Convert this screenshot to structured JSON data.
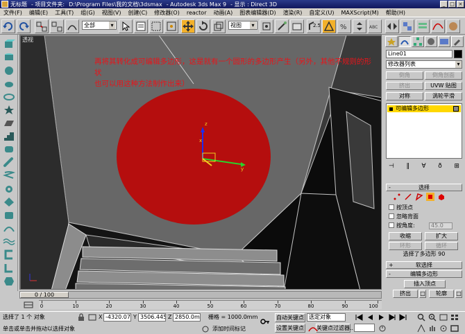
{
  "titlebar": {
    "doc": "无标题",
    "project_label": "- 项目文件夹:",
    "project_path": "D:\\Program Files\\我的文档\\3dsmax",
    "app": "- Autodesk 3ds Max 9",
    "display": "- 显示 : Direct 3D"
  },
  "menu": [
    "文件(F)",
    "编辑(E)",
    "工具(T)",
    "组(G)",
    "视图(V)",
    "创建(C)",
    "修改器(O)",
    "reactor",
    "动画(A)",
    "图表编辑器(D)",
    "渲染(R)",
    "自定义(U)",
    "MAXScript(M)",
    "帮助(H)"
  ],
  "toolbar": {
    "selection_filter": "全部",
    "coord_system": "视图",
    "snap_label": "2.5",
    "named_sel_label": "ABC"
  },
  "viewport": {
    "label": "透视",
    "annotation_line1": "再将其转化成可编辑多边形，这是就有一个圆形的多边形产生（另外，其他不规则的形状",
    "annotation_line2": "也可以用这种方法制作出来）",
    "colors": {
      "disk": "#b50e0e",
      "annotation": "#e8141a"
    }
  },
  "command_panel": {
    "object_name": "Line01",
    "modifier_list": "修改器列表",
    "buttons": [
      "倒角",
      "倒角剖面",
      "挤出",
      "UVW 贴图",
      "对称",
      "涡轮平滑"
    ],
    "stack_item": "可编辑多边形",
    "select_rollout": {
      "title": "选择",
      "by_vertex": "按顶点",
      "ignore_backfacing": "忽略背面",
      "by_angle": "按角度:",
      "angle_value": "45.0",
      "shrink": "收缩",
      "grow": "扩大",
      "ring": "环形",
      "loop": "循环",
      "status": "选择了多边形 90"
    },
    "soft_selection": "软选择",
    "edit_polygons": {
      "title": "编辑多边形",
      "insert_vertex": "插入顶点",
      "extrude": "挤出",
      "outline": "轮廓",
      "bevel": "倒角",
      "inset": "插入"
    }
  },
  "timeline": {
    "slider": "0 / 100",
    "ticks": [
      "0",
      "10",
      "20",
      "30",
      "40",
      "50",
      "60",
      "70",
      "80",
      "90",
      "100"
    ]
  },
  "status": {
    "selected": "选择了 1 个 对象",
    "prompt": "单击或单击并拖动以选择对象",
    "x_label": "X",
    "x_value": "-4320.075",
    "y_label": "Y",
    "y_value": "3506.445m",
    "z_label": "Z",
    "z_value": "2850.0mm",
    "grid": "栅格 = 1000.0mm",
    "add_time_tag": "添加时间标记",
    "auto_key": "自动关键点",
    "set_key": "设置关键点",
    "key_mode": "选定对象",
    "key_filters": "关键点过滤器..."
  }
}
